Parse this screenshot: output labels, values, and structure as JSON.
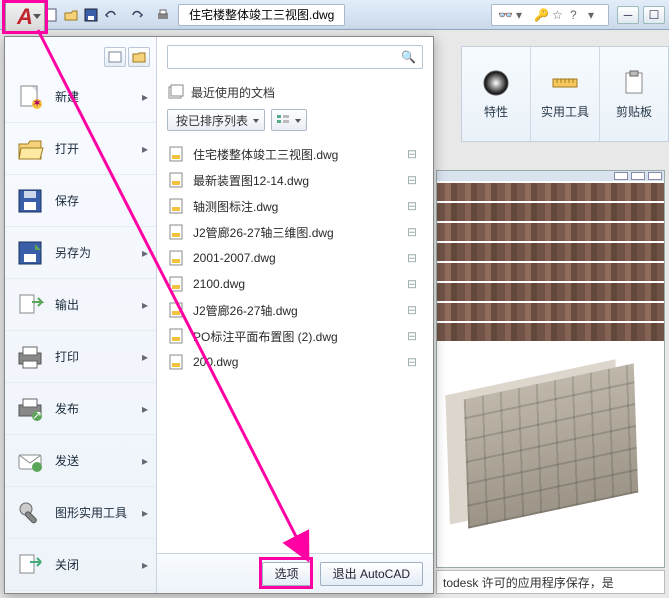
{
  "titlebar": {
    "doc": "住宅楼整体竣工三视图.dwg"
  },
  "ribbon": {
    "props": "特性",
    "tools": "实用工具",
    "clip": "剪贴板"
  },
  "appmenu": {
    "items": [
      {
        "label": "新建",
        "arrow": true
      },
      {
        "label": "打开",
        "arrow": true
      },
      {
        "label": "保存",
        "arrow": false
      },
      {
        "label": "另存为",
        "arrow": true
      },
      {
        "label": "输出",
        "arrow": true
      },
      {
        "label": "打印",
        "arrow": true
      },
      {
        "label": "发布",
        "arrow": true
      },
      {
        "label": "发送",
        "arrow": true
      },
      {
        "label": "图形实用工具",
        "arrow": true
      },
      {
        "label": "关闭",
        "arrow": true
      }
    ],
    "recent_header": "最近使用的文档",
    "sort_label": "按已排序列表",
    "files": [
      "住宅楼整体竣工三视图.dwg",
      "最新装置图12-14.dwg",
      "轴测图标注.dwg",
      "J2管廊26-27轴三维图.dwg",
      "2001-2007.dwg",
      "2100.dwg",
      "J2管廊26-27轴.dwg",
      "PO标注平面布置图 (2).dwg",
      "200.dwg"
    ],
    "footer": {
      "options": "选项",
      "exit": "退出 AutoCAD"
    }
  },
  "note": "todesk 许可的应用程序保存，是"
}
